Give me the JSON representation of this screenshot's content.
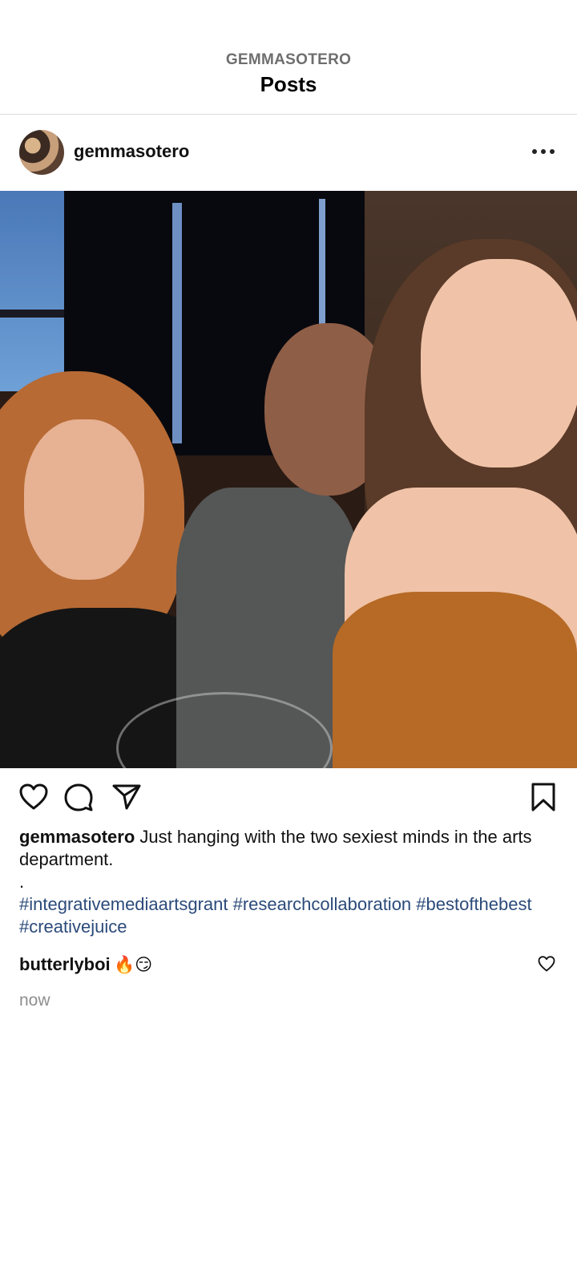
{
  "header": {
    "account": "GEMMASOTERO",
    "title": "Posts"
  },
  "post": {
    "username": "gemmasotero",
    "photo_alt": "Three people taking a selfie together",
    "caption": {
      "username": "gemmasotero",
      "text": "Just hanging with the two sexiest minds in the arts department.",
      "separator": ".",
      "hashtags": "#integrativemediaartsgrant #researchcollaboration #bestofthebest #creativejuice"
    },
    "actions": {
      "like_icon": "heart-icon",
      "comment_icon": "comment-icon",
      "share_icon": "send-icon",
      "save_icon": "bookmark-icon"
    },
    "comments": [
      {
        "username": "butterlyboi",
        "text": "🔥😏"
      }
    ],
    "timestamp": "now"
  }
}
